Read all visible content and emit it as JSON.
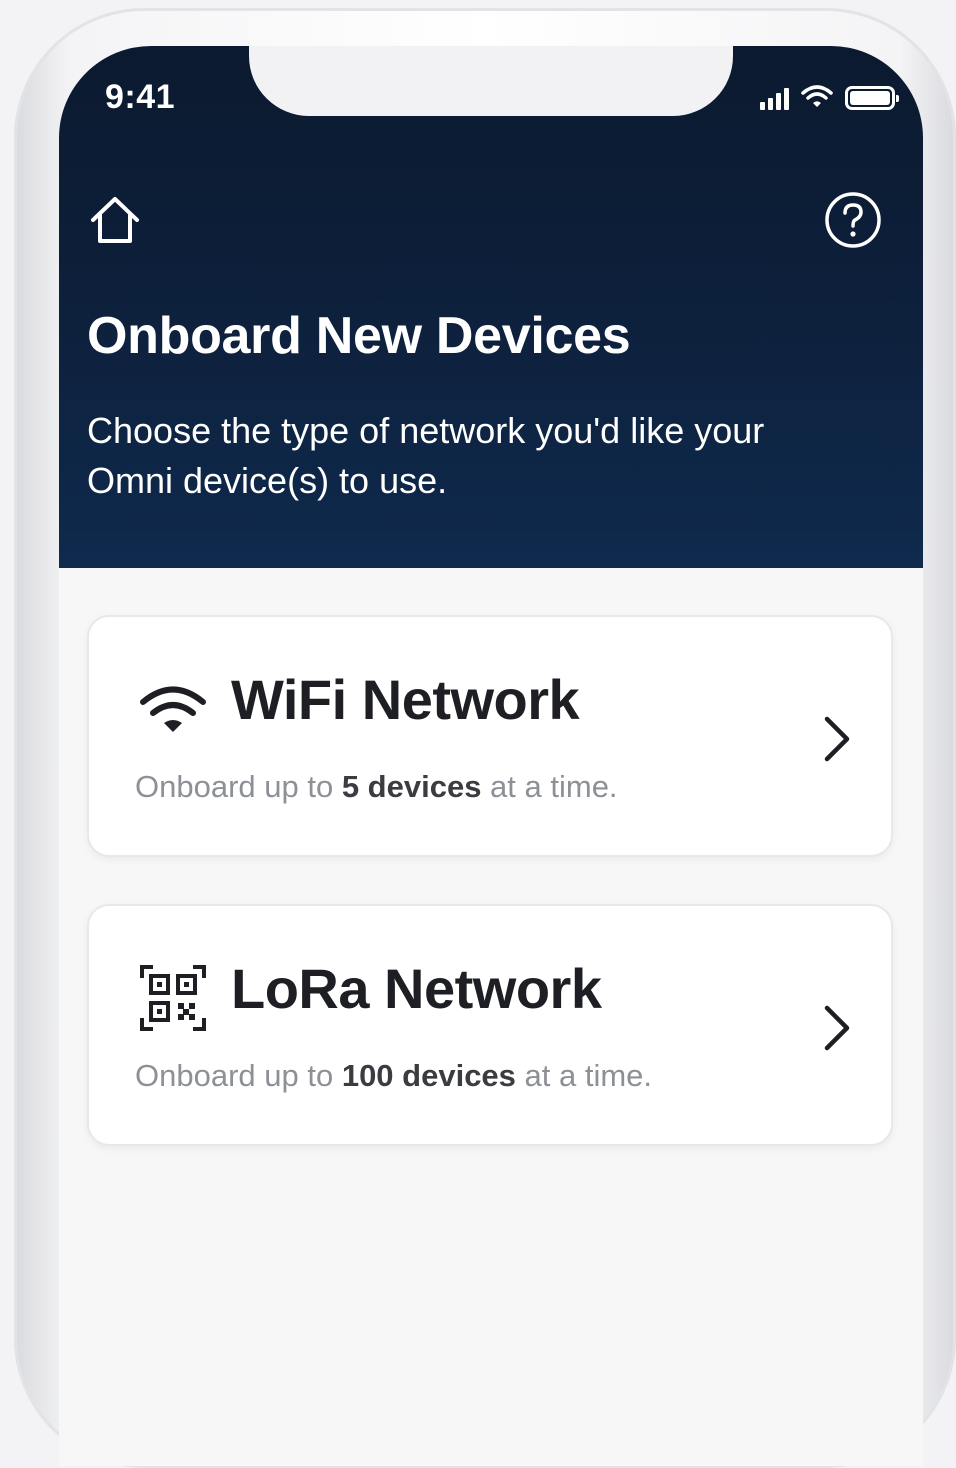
{
  "status_bar": {
    "time": "9:41"
  },
  "header": {
    "title": "Onboard New Devices",
    "subtitle": "Choose the type of network you'd like your Omni device(s) to use."
  },
  "icons": {
    "home": "home-icon",
    "help": "help-icon",
    "wifi": "wifi-icon",
    "qr": "qr-code-icon",
    "chevron": "chevron-right-icon"
  },
  "options": [
    {
      "title": "WiFi Network",
      "desc_prefix": "Onboard up to ",
      "desc_bold": "5 devices",
      "desc_suffix": " at a time."
    },
    {
      "title": "LoRa Network",
      "desc_prefix": "Onboard up to ",
      "desc_bold": "100 devices",
      "desc_suffix": " at a time."
    }
  ],
  "colors": {
    "header_bg": "#0d1f3a",
    "card_bg": "#ffffff",
    "title_text": "#1e1f24",
    "desc_text": "#8d9096"
  }
}
